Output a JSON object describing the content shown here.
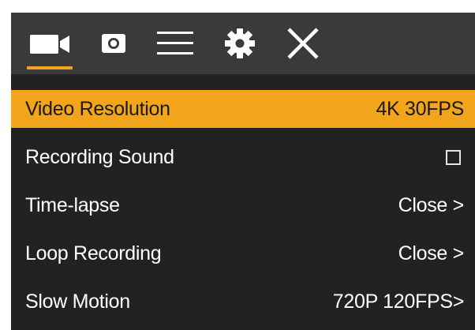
{
  "toolbar": {
    "items": [
      {
        "icon": "video-camera-icon",
        "active": true
      },
      {
        "icon": "photo-camera-icon",
        "active": false
      },
      {
        "icon": "menu-icon",
        "active": false
      },
      {
        "icon": "gear-icon",
        "active": false
      },
      {
        "icon": "close-icon",
        "active": false
      }
    ],
    "accent_color": "#f2a51a"
  },
  "menu": {
    "items": [
      {
        "label": "Video Resolution",
        "value": "4K 30FPS",
        "selected": true
      },
      {
        "label": "Recording Sound",
        "value": "",
        "type": "checkbox",
        "checked": false,
        "selected": false
      },
      {
        "label": "Time-lapse",
        "value": "Close >",
        "selected": false
      },
      {
        "label": "Loop Recording",
        "value": "Close >",
        "selected": false
      },
      {
        "label": "Slow Motion",
        "value": "720P 120FPS>",
        "selected": false
      }
    ]
  }
}
